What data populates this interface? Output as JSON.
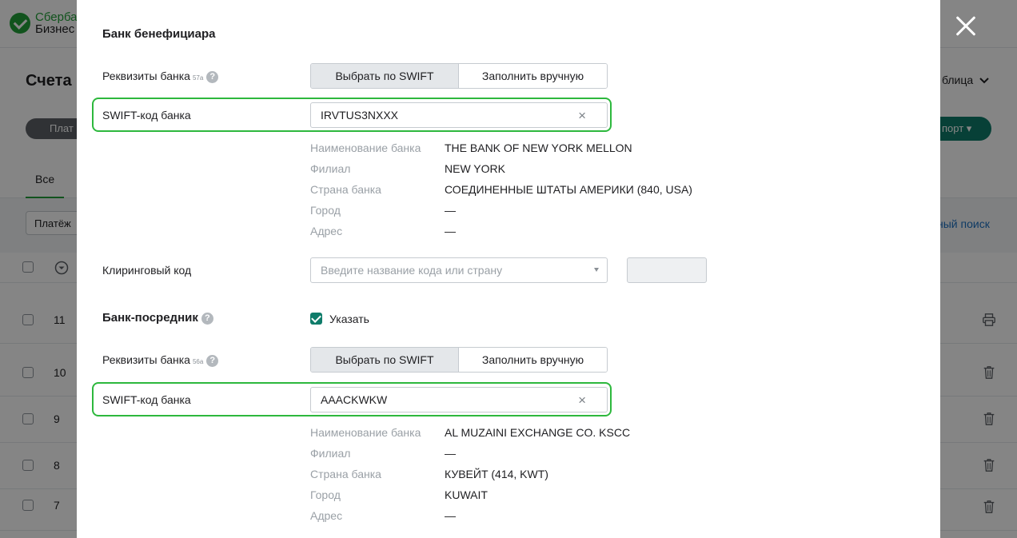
{
  "background": {
    "logo": {
      "line1": "Сберба",
      "line2": "Бизнес"
    },
    "page_title": "Счета н",
    "view_toggle": "блица",
    "left_pill": "Плат",
    "right_pill": "порт ▾",
    "tab_all": "Все",
    "filter": "Платёж",
    "extended_search": "ный поиск",
    "rows": [
      "11",
      "10",
      "9",
      "8",
      "7"
    ]
  },
  "modal": {
    "beneficiary_bank": {
      "title": "Банк бенефициара",
      "bank_details_label": "Реквизиты банка",
      "bank_details_code": "57a",
      "help_icon": "?",
      "mode_swift": "Выбрать по SWIFT",
      "mode_manual": "Заполнить вручную",
      "swift_label": "SWIFT-код банка",
      "swift_value": "IRVTUS3NXXX",
      "clear_symbol": "×",
      "info": [
        {
          "label": "Наименование банка",
          "value": "THE BANK OF NEW YORK MELLON"
        },
        {
          "label": "Филиал",
          "value": "NEW YORK"
        },
        {
          "label": "Страна банка",
          "value": "СОЕДИНЕННЫЕ ШТАТЫ АМЕРИКИ (840, USA)"
        },
        {
          "label": "Город",
          "value": "—"
        },
        {
          "label": "Адрес",
          "value": "—"
        }
      ],
      "clearing_label": "Клиринговый код",
      "clearing_placeholder": "Введите название кода или страну",
      "clearing_code_value": ""
    },
    "intermediary_bank": {
      "title": "Банк-посредник",
      "help_icon": "?",
      "specify_label": "Указать",
      "specify_checked": true,
      "bank_details_label": "Реквизиты банка",
      "bank_details_code": "56a",
      "mode_swift": "Выбрать по SWIFT",
      "mode_manual": "Заполнить вручную",
      "swift_label": "SWIFT-код банка",
      "swift_value": "AAACKWKW",
      "clear_symbol": "×",
      "info": [
        {
          "label": "Наименование банка",
          "value": "AL MUZAINI EXCHANGE CO. KSCC"
        },
        {
          "label": "Филиал",
          "value": "—"
        },
        {
          "label": "Страна банка",
          "value": "КУВЕЙТ (414, KWT)"
        },
        {
          "label": "Город",
          "value": "KUWAIT"
        },
        {
          "label": "Адрес",
          "value": "—"
        }
      ]
    }
  },
  "colors": {
    "accent_green": "#2db83d",
    "checkbox_teal": "#0f7c6a",
    "muted_text": "#9aa0a6"
  }
}
